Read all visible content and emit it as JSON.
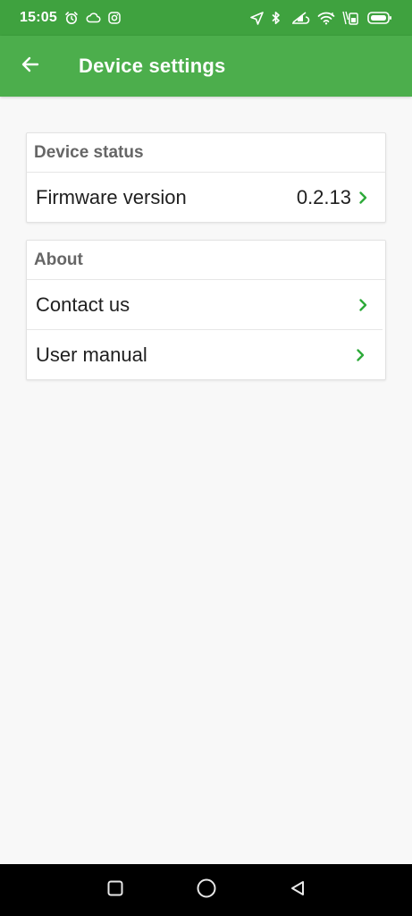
{
  "status_bar": {
    "time": "15:05",
    "left_icons": [
      "alarm-icon",
      "cloud-icon",
      "instagram-icon"
    ],
    "right_icons": [
      "location-icon",
      "bluetooth-icon",
      "data-saver-icon",
      "wifi-icon",
      "sim-icon",
      "battery-icon"
    ]
  },
  "app_bar": {
    "title": "Device settings",
    "back_icon": "arrow-left-icon"
  },
  "sections": {
    "device_status": {
      "header": "Device status",
      "firmware": {
        "label": "Firmware version",
        "value": "0.2.13"
      }
    },
    "about": {
      "header": "About",
      "contact": {
        "label": "Contact us"
      },
      "manual": {
        "label": "User manual"
      }
    }
  },
  "colors": {
    "status_bar": "#3fa23f",
    "app_bar": "#4cae4c",
    "chevron": "#2eaa3a",
    "background": "#f8f8f8"
  },
  "nav_bar": {
    "buttons": [
      "recents-square-icon",
      "home-circle-icon",
      "back-triangle-icon"
    ]
  }
}
